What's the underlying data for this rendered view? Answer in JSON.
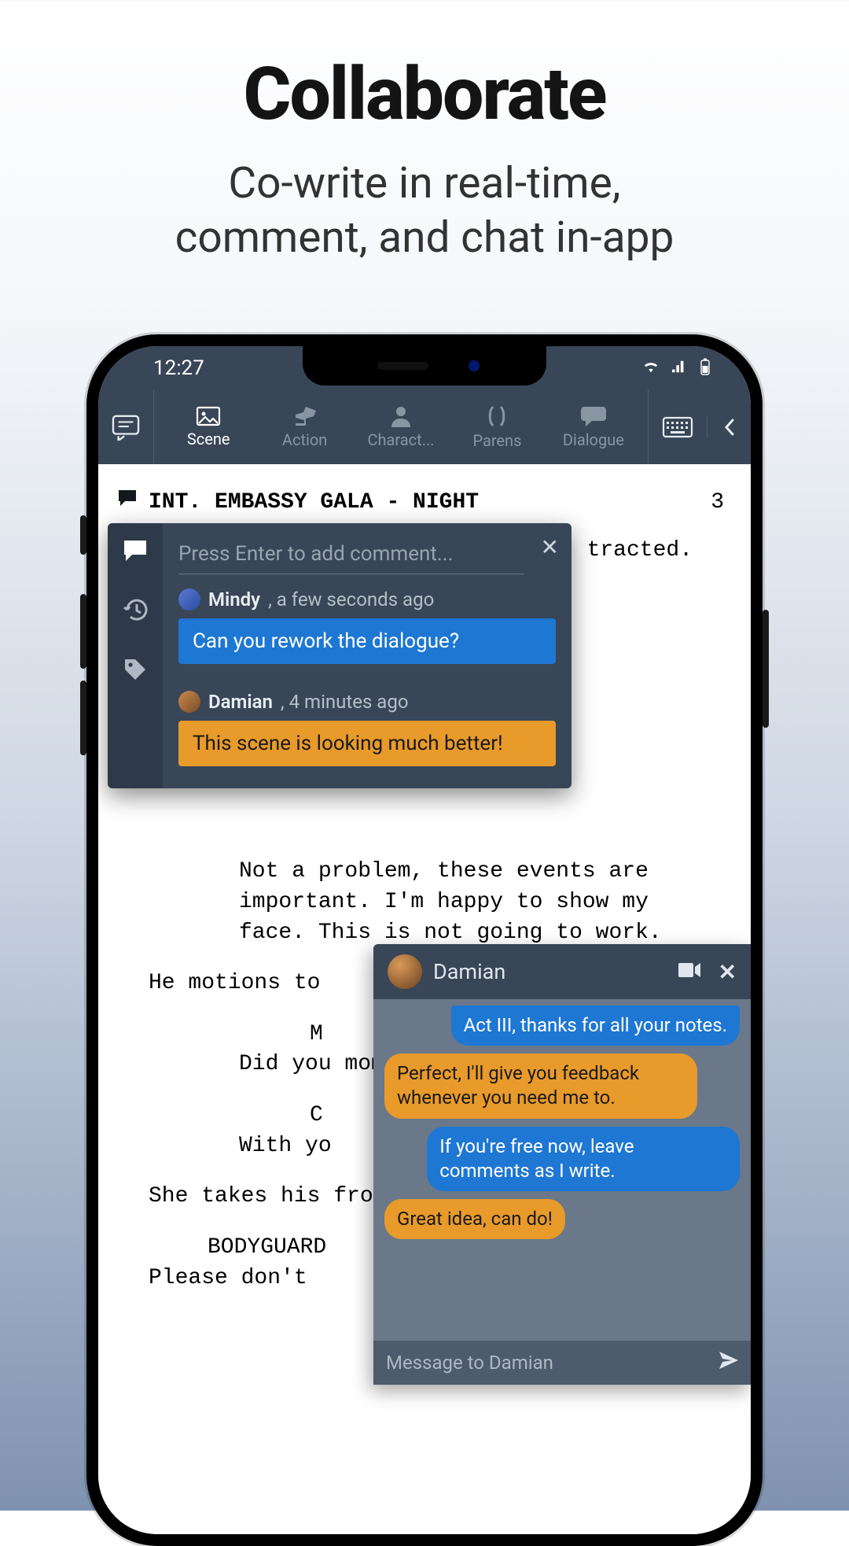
{
  "promo": {
    "title": "Collaborate",
    "subtitle": "Co-write in real-time,\ncomment, and chat in-app"
  },
  "status": {
    "time": "12:27"
  },
  "toolbar": {
    "items": [
      {
        "label": "Scene"
      },
      {
        "label": "Action"
      },
      {
        "label": "Charact..."
      },
      {
        "label": "Parens"
      },
      {
        "label": "Dialogue"
      }
    ]
  },
  "script": {
    "scene_heading": "INT. EMBASSY GALA - NIGHT",
    "page_number": "3",
    "action_suffix": "tracted.",
    "dialogue1": "Not a problem, these events are important. I'm happy to show my face. This is not going to work.",
    "action2": "He motions to",
    "char_m": "M",
    "dialogue2": "Did you moment a priva",
    "char_c": "C",
    "dialogue3": "With yo",
    "action3": "She takes his from the part",
    "char_bg": "BODYGUARD",
    "dialogue4": "Please don't"
  },
  "comments": {
    "input_placeholder": "Press Enter to add comment...",
    "entries": [
      {
        "author": "Mindy",
        "meta": ", a few seconds ago",
        "text": "Can you rework the dialogue?",
        "color": "blue"
      },
      {
        "author": "Damian",
        "meta": ", 4 minutes ago",
        "text": "This scene is looking much better!",
        "color": "orange"
      }
    ]
  },
  "chat": {
    "contact": "Damian",
    "messages": [
      {
        "dir": "in",
        "text": "Act III, thanks for all your notes."
      },
      {
        "dir": "out",
        "text": "Perfect, I'll give you feedback whenever you need me to."
      },
      {
        "dir": "in",
        "text": "If you're free now, leave comments as I write."
      },
      {
        "dir": "out",
        "text": "Great idea, can do!"
      }
    ],
    "input_placeholder": "Message to Damian"
  }
}
